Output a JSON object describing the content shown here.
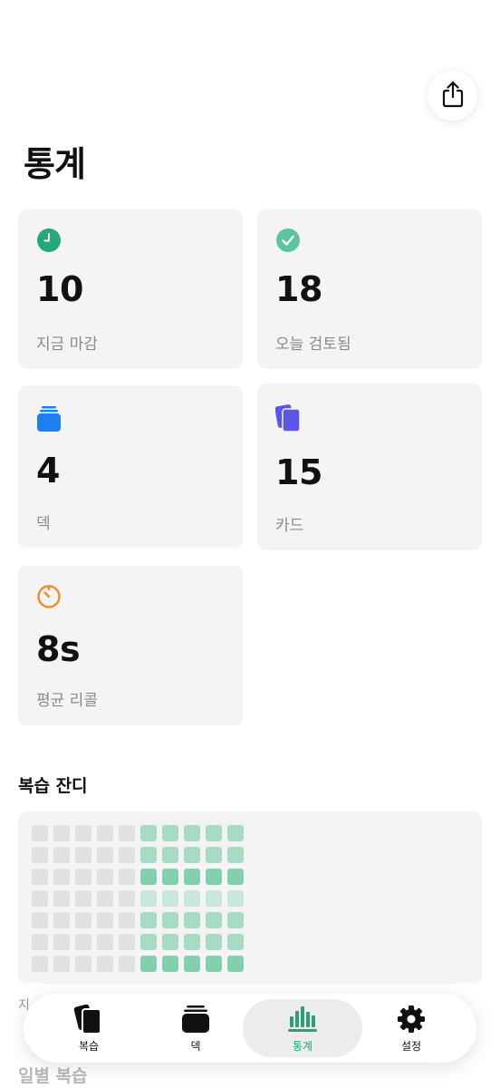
{
  "header": {
    "title": "통계",
    "share_icon": "share-icon"
  },
  "stats": [
    {
      "value": "10",
      "label": "지금 마감",
      "icon": "clock-icon",
      "color": "#25a97a"
    },
    {
      "value": "18",
      "label": "오늘 검토됨",
      "icon": "checkmark-circle-icon",
      "color": "#5ec3a0"
    },
    {
      "value": "4",
      "label": "덱",
      "icon": "tray-stack-icon",
      "color": "#1f7ef0"
    },
    {
      "value": "15",
      "label": "카드",
      "icon": "cards-stack-icon",
      "color": "#5d55e6"
    },
    {
      "value": "8s",
      "label": "평균 리콜",
      "icon": "timer-icon",
      "color": "#f08b2a"
    }
  ],
  "heatmap": {
    "title": "복습 잔디",
    "columns": 10,
    "rows": 7,
    "levels": [
      [
        0,
        0,
        0,
        0,
        0,
        2,
        2,
        2,
        2,
        2
      ],
      [
        0,
        0,
        0,
        0,
        0,
        2,
        2,
        2,
        2,
        2
      ],
      [
        0,
        0,
        0,
        0,
        0,
        3,
        3,
        3,
        3,
        3
      ],
      [
        0,
        0,
        0,
        0,
        0,
        1,
        1,
        1,
        1,
        1
      ],
      [
        0,
        0,
        0,
        0,
        0,
        2,
        2,
        2,
        2,
        2
      ],
      [
        0,
        0,
        0,
        0,
        0,
        2,
        2,
        2,
        2,
        2
      ],
      [
        0,
        0,
        0,
        0,
        0,
        3,
        3,
        3,
        3,
        3
      ]
    ],
    "level_colors": [
      "#e2e2e2",
      "#c8e8db",
      "#a6dcc4",
      "#84cfae"
    ]
  },
  "behind": {
    "partial_text": "지",
    "next_section_title": "일별 복습"
  },
  "tabbar": {
    "tabs": [
      {
        "label": "복습",
        "icon": "review-cards-icon",
        "active": false
      },
      {
        "label": "덱",
        "icon": "deck-tray-icon",
        "active": false
      },
      {
        "label": "통계",
        "icon": "stats-chart-icon",
        "active": true
      },
      {
        "label": "설정",
        "icon": "gear-icon",
        "active": false
      }
    ],
    "active_color": "#2e9e76"
  }
}
